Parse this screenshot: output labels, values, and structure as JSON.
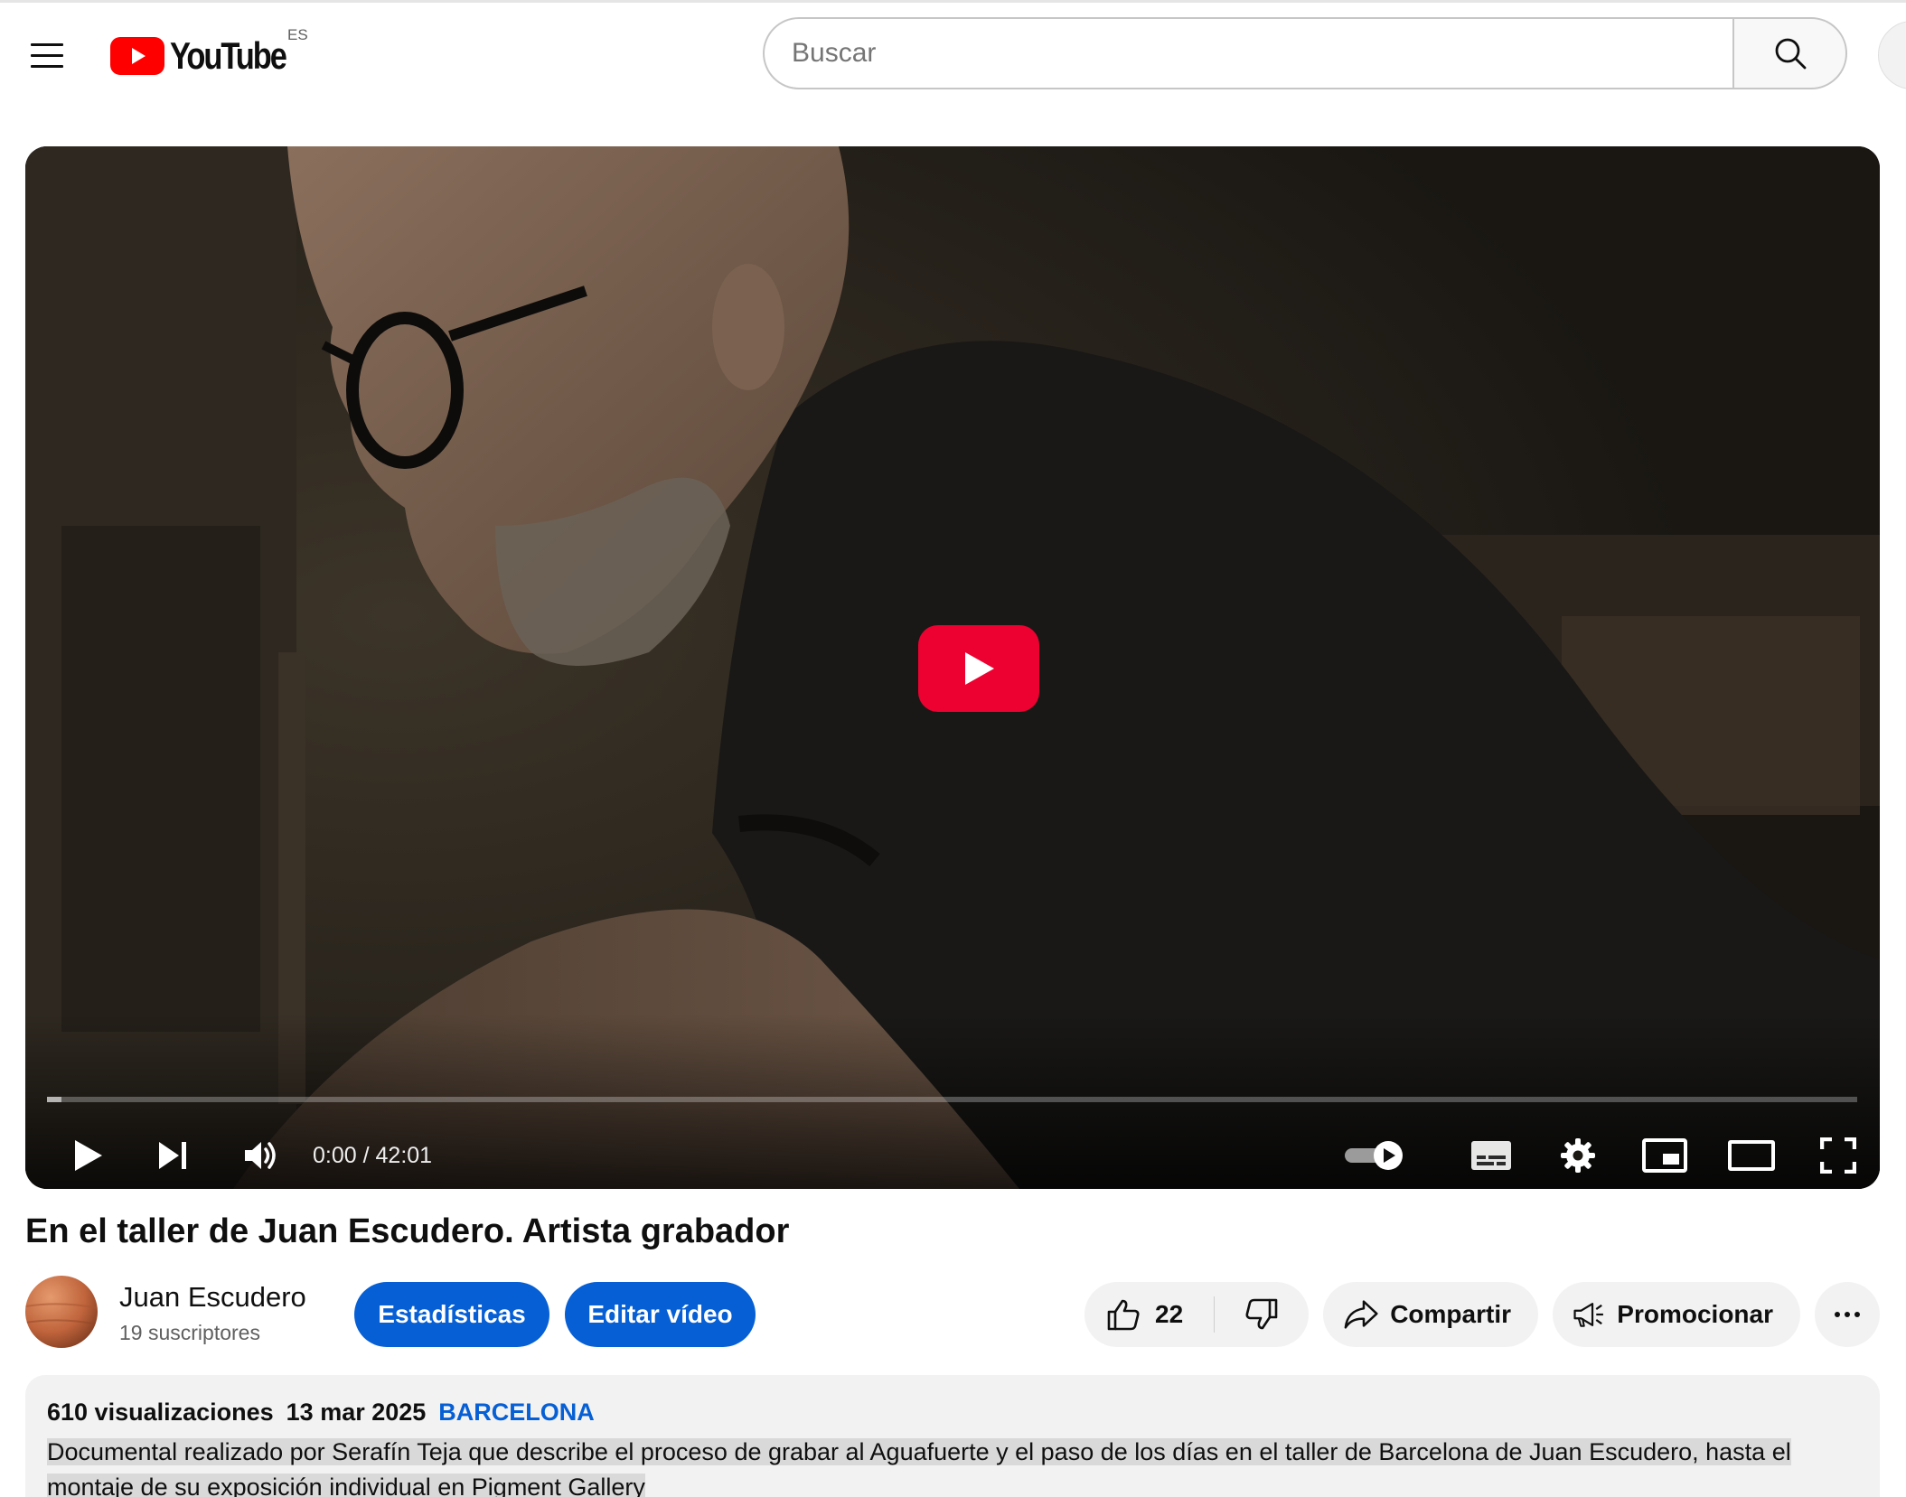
{
  "masthead": {
    "menu_icon": "hamburger-menu-icon",
    "logo_text": "YouTube",
    "country_code": "ES",
    "search_placeholder": "Buscar",
    "search_icon": "search-icon"
  },
  "player": {
    "current_time": "0:00",
    "separator": " / ",
    "duration": "42:01",
    "progress_fraction": 0.0,
    "controls": [
      "play-icon",
      "next-icon",
      "volume-icon",
      "autoplay-toggle-icon",
      "subtitles-icon",
      "settings-gear-icon",
      "miniplayer-icon",
      "theater-mode-icon",
      "fullscreen-icon"
    ]
  },
  "video": {
    "title": "En el taller de Juan Escudero. Artista grabador"
  },
  "owner": {
    "channel_name": "Juan Escudero",
    "subscribers": "19 suscriptores",
    "stats_label": "Estadísticas",
    "edit_label": "Editar vídeo"
  },
  "actions": {
    "like_count": "22",
    "share_label": "Compartir",
    "promote_label": "Promocionar"
  },
  "description": {
    "views": "610 visualizaciones",
    "date": "13 mar 2025",
    "location_tag": "BARCELONA",
    "text": "Documental realizado por Serafín Teja que describe el proceso de grabar al Aguafuerte y el paso de los días en el taller de Barcelona de Juan Escudero, hasta el montaje de su exposición individual en Pigment Gallery"
  },
  "colors": {
    "brand_red": "#ff0000",
    "button_blue": "#065fd4",
    "pill_grey": "#f2f2f2",
    "tag_blue": "#065fd4"
  }
}
